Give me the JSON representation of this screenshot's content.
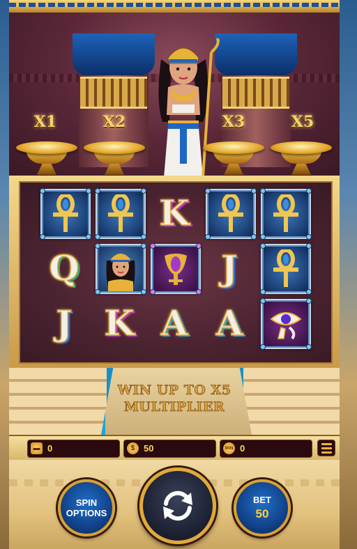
{
  "multipliers": [
    "X1",
    "X2",
    "X3",
    "X5"
  ],
  "banner": {
    "line1": "WIN UP TO X5",
    "line2": "MULTIPLIER"
  },
  "reels": [
    [
      "ankh",
      "ankh",
      "K",
      "ankh",
      "ankh"
    ],
    [
      "Q",
      "queen-wild",
      "scarab",
      "J",
      "ankh"
    ],
    [
      "J",
      "K",
      "A",
      "A",
      "eye-of-horus"
    ]
  ],
  "status_bar": {
    "balance": "0",
    "stake": "50",
    "win": "0",
    "win_badge": "WIN",
    "coin_badge": "$"
  },
  "controls": {
    "spin_options_line1": "SPIN",
    "spin_options_line2": "OPTIONS",
    "bet_label": "BET",
    "bet_value": "50"
  },
  "icons": {
    "wallet": "wallet-icon",
    "coin": "coin-icon",
    "win": "win-icon",
    "menu": "menu-icon",
    "spin": "spin-arrows-icon"
  },
  "colors": {
    "gold": "#d6a234",
    "button_blue": "#12428a",
    "bet_value": "#ffd23a"
  }
}
